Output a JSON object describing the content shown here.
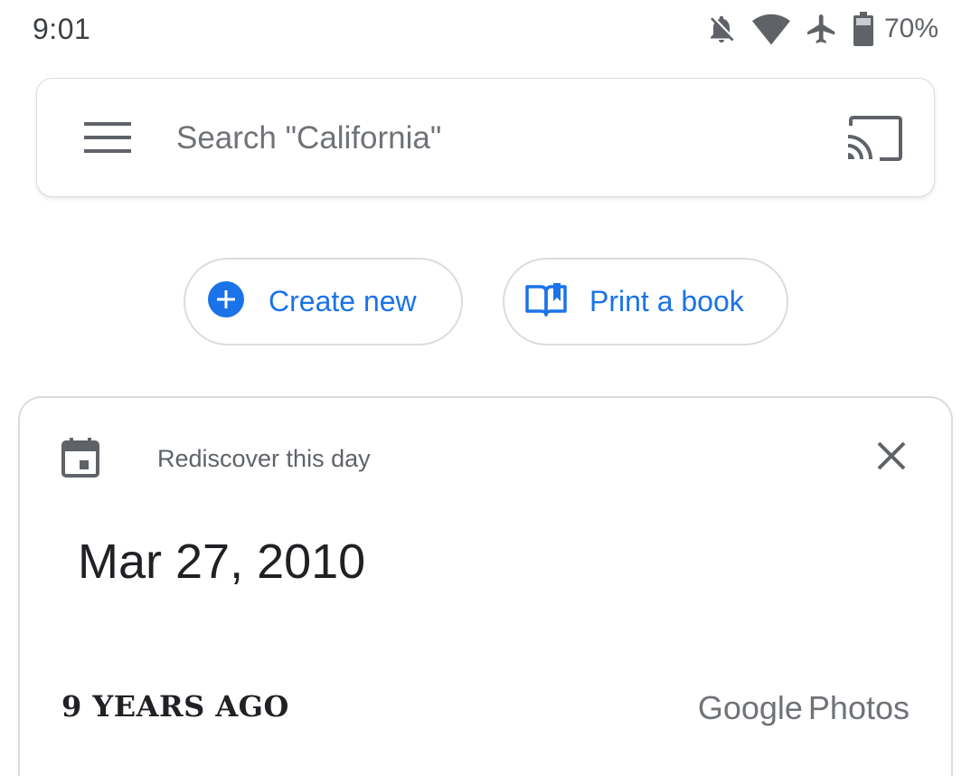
{
  "status_bar": {
    "time": "9:01",
    "battery_percent": "70%",
    "icons": [
      "notifications-off-icon",
      "wifi-icon",
      "airplane-mode-icon",
      "battery-icon"
    ]
  },
  "search": {
    "placeholder": "Search \"California\"",
    "value": ""
  },
  "actions": {
    "create_label": "Create new",
    "print_label": "Print a book"
  },
  "memory_card": {
    "label": "Rediscover this day",
    "date": "Mar 27, 2010",
    "years_ago": "9 YEARS AGO",
    "brand_first": "Google",
    "brand_second": "Photos"
  },
  "colors": {
    "accent": "#1a73e8",
    "icon_gray": "#5f6368",
    "border": "#dadce0"
  }
}
